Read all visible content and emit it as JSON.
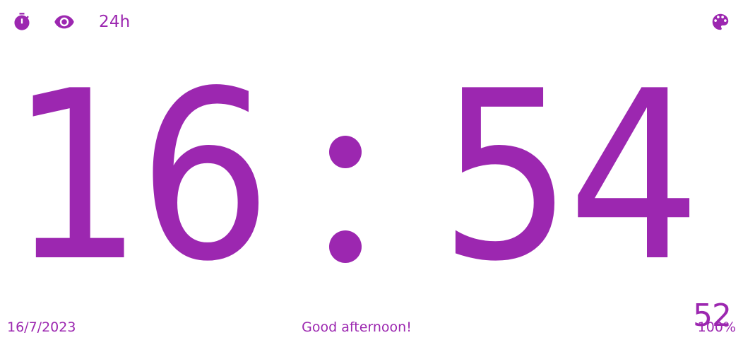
{
  "toolbar": {
    "format_label": "24h",
    "timer_icon": "stopwatch-icon",
    "visibility_icon": "eye-icon",
    "theme_icon": "palette-icon"
  },
  "clock": {
    "hours": "16",
    "minutes": "54",
    "seconds": "52",
    "separator": ":"
  },
  "footer": {
    "date": "16/7/2023",
    "greeting": "Good afternoon!",
    "battery": "100%"
  },
  "colors": {
    "accent": "#9c27b0",
    "background": "#ffffff"
  }
}
